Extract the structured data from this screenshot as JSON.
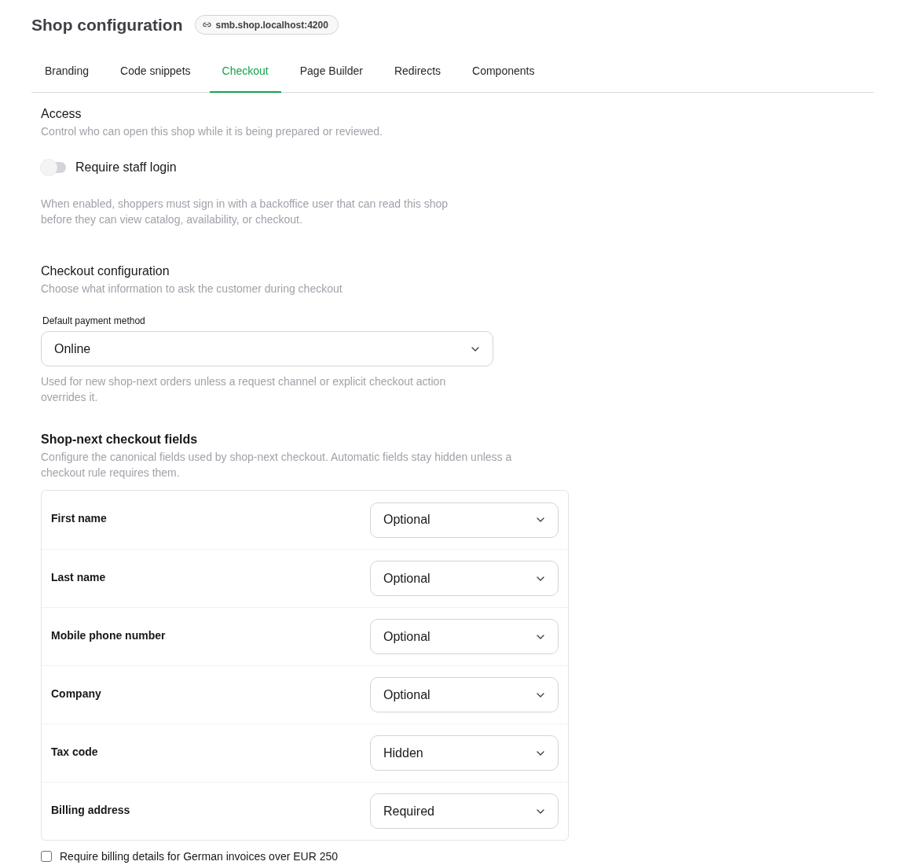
{
  "header": {
    "title": "Shop configuration",
    "domain": "smb.shop.localhost:4200"
  },
  "tabs": [
    {
      "label": "Branding",
      "selected": false
    },
    {
      "label": "Code snippets",
      "selected": false
    },
    {
      "label": "Checkout",
      "selected": true
    },
    {
      "label": "Page Builder",
      "selected": false
    },
    {
      "label": "Redirects",
      "selected": false
    },
    {
      "label": "Components",
      "selected": false
    }
  ],
  "access": {
    "title": "Access",
    "subtitle": "Control who can open this shop while it is being prepared or reviewed.",
    "toggle": {
      "label": "Require staff login",
      "on": false
    },
    "help": "When enabled, shoppers must sign in with a backoffice user that can read this shop before they can view catalog, availability, or checkout."
  },
  "checkout_configuration": {
    "title": "Checkout configuration",
    "subtitle": "Choose what information to ask the customer during checkout",
    "payment_method": {
      "label": "Default payment method",
      "value": "Online"
    },
    "help": "Used for new shop-next orders unless a request channel or explicit checkout action overrides it."
  },
  "checkout_fields": {
    "title": "Shop-next checkout fields",
    "description": "Configure the canonical fields used by shop-next checkout. Automatic fields stay hidden unless a checkout rule requires them.",
    "rows": [
      {
        "label": "First name",
        "value": "Optional"
      },
      {
        "label": "Last name",
        "value": "Optional"
      },
      {
        "label": "Mobile phone number",
        "value": "Optional"
      },
      {
        "label": "Company",
        "value": "Optional"
      },
      {
        "label": "Tax code",
        "value": "Hidden"
      },
      {
        "label": "Billing address",
        "value": "Required"
      }
    ]
  },
  "billing_checkbox": {
    "label": "Require billing details for German invoices over EUR 250",
    "checked": false
  }
}
